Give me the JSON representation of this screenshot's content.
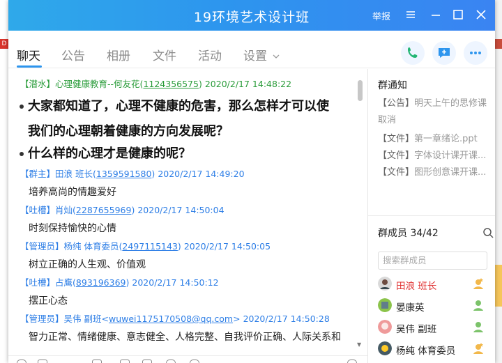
{
  "window": {
    "title": "19环境艺术设计班",
    "report_label": "举报"
  },
  "background": {
    "left_tag": "D"
  },
  "tabs": [
    {
      "label": "聊天",
      "active": true
    },
    {
      "label": "公告",
      "active": false
    },
    {
      "label": "相册",
      "active": false
    },
    {
      "label": "文件",
      "active": false
    },
    {
      "label": "活动",
      "active": false
    },
    {
      "label": "设置",
      "active": false
    }
  ],
  "messages": {
    "m1": {
      "role": "【潜水】",
      "name": "心理健康教育--何友花",
      "id": "1124356575",
      "time": "2020/2/17 14:48:22"
    },
    "big1": "大家都知道了，心理不健康的危害，那么怎样才可以使",
    "big2": "我们的心理朝着健康的方向发展呢？",
    "big3": "什么样的心理才是健康的呢？",
    "m2": {
      "role": "【群主】",
      "name": "田浪  班长",
      "id": "1359591580",
      "time": "2020/2/17 14:49:20",
      "text": "培养高尚的情趣爱好"
    },
    "m3": {
      "role": "【吐槽】",
      "name": "肖灿",
      "id": "2287655969",
      "time": "2020/2/17 14:50:04",
      "text": "时刻保持愉快的心情"
    },
    "m4": {
      "role": "【管理员】",
      "name": "杨纯  体育委员",
      "id": "2497115143",
      "time": "2020/2/17 14:50:05",
      "text": "树立正确的人生观、价值观"
    },
    "m5": {
      "role": "【吐槽】",
      "name": "占鹰",
      "id": "893196369",
      "time": "2020/2/17 14:50:12",
      "text": "摆正心态"
    },
    "m6": {
      "role": "【管理员】",
      "name": "吴伟    副班",
      "email": "wuwei1175170508@qq.com",
      "time": "2020/2/17 14:50:28",
      "text": "智力正常、情绪健康、意志健全、人格完整、自我评价正确、人际关系和"
    }
  },
  "side": {
    "notice_title": "群通知",
    "notices": [
      {
        "tag": "【公告】",
        "text": "明天上午的思修课"
      },
      {
        "tag": "",
        "text": "取消"
      },
      {
        "tag": "【文件】",
        "text": "第一章绪论.ppt"
      },
      {
        "tag": "【文件】",
        "text": "字体设计课开课..."
      },
      {
        "tag": "【文件】",
        "text": "图形创意课开课..."
      }
    ],
    "members_title": "群成员 34/42",
    "member_search_placeholder": "搜索群成员",
    "members": [
      {
        "name": "田浪  班长",
        "highlight": true
      },
      {
        "name": "晏康英",
        "highlight": false
      },
      {
        "name": "吴伟  副班",
        "highlight": false
      },
      {
        "name": "杨纯  体育委员",
        "highlight": false
      }
    ]
  },
  "colors": {
    "accent": "#2d95ee",
    "role_blue": "#2d7ee6",
    "role_green": "#2a9c3a",
    "owner_red": "#e03131"
  }
}
